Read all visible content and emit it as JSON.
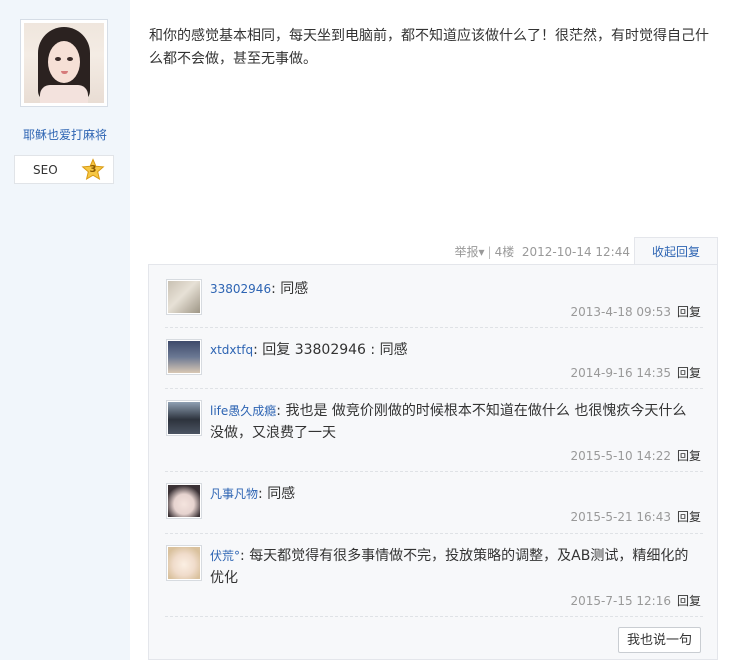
{
  "author": {
    "name": "耶稣也爱打麻将",
    "level_label": "SEO",
    "level_number": "3",
    "level_color": "#f4b72a"
  },
  "post": {
    "text": "和你的感觉基本相同，每天坐到电脑前，都不知道应该做什么了！很茫然，有时觉得自己什么都不会做，甚至无事做。",
    "report_label": "举报",
    "floor": "4楼",
    "timestamp": "2012-10-14 12:44",
    "collapse_label": "收起回复"
  },
  "replies": [
    {
      "user": "33802946",
      "text": "同感",
      "time": "2013-4-18 09:53",
      "reply_label": "回复"
    },
    {
      "user": "xtdxtfq",
      "text": "回复 33802946 : 同感",
      "time": "2014-9-16 14:35",
      "reply_label": "回复"
    },
    {
      "user": "life愚久成瘾",
      "text": "我也是 做竞价刚做的时候根本不知道在做什么 也很愧疚今天什么没做，又浪费了一天",
      "time": "2015-5-10 14:22",
      "reply_label": "回复"
    },
    {
      "user": "凡事凡物",
      "text": "同感",
      "time": "2015-5-21 16:43",
      "reply_label": "回复"
    },
    {
      "user": "伏荒°",
      "text": "每天都觉得有很多事情做不完，投放策略的调整，及AB测试，精细化的优化",
      "time": "2015-7-15 12:16",
      "reply_label": "回复"
    }
  ],
  "write_label": "我也说一句",
  "colors": {
    "link": "#2d64b3",
    "sidebar_bg": "#f1f6fb",
    "reply_bg": "#f7f8fa",
    "meta": "#999999"
  }
}
